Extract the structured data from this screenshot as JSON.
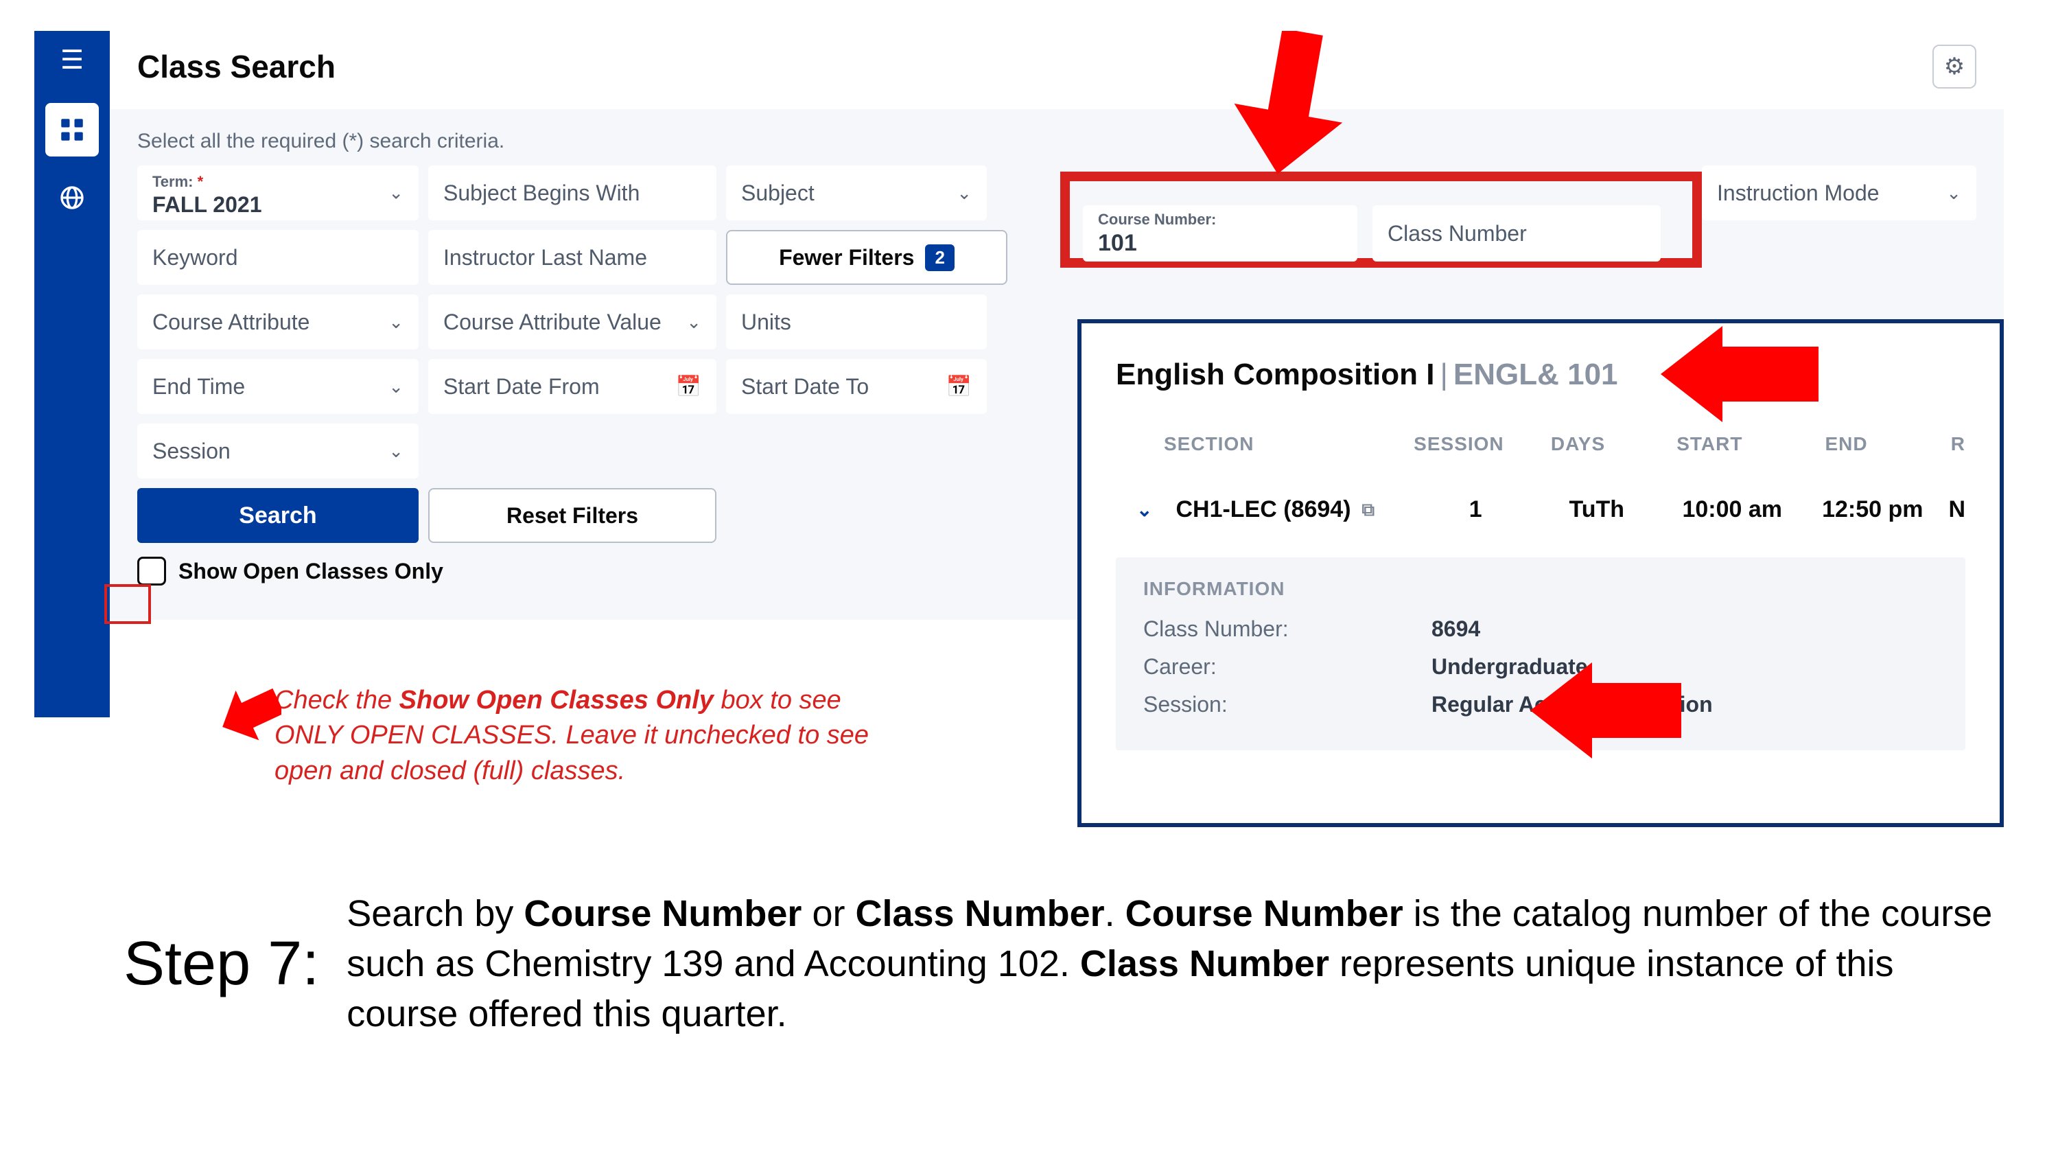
{
  "header": {
    "title": "Class Search"
  },
  "filters": {
    "criteria_label": "Select all the required (*) search criteria.",
    "term": {
      "label": "Term:",
      "required_mark": "*",
      "value": "FALL 2021"
    },
    "subject_begins": "Subject Begins With",
    "subject": "Subject",
    "course_number": {
      "label": "Course Number:",
      "value": "101"
    },
    "class_number_placeholder": "Class Number",
    "instruction_mode": "Instruction Mode",
    "keyword": "Keyword",
    "instructor_last_name": "Instructor Last Name",
    "fewer_filters": {
      "label": "Fewer Filters",
      "badge": "2"
    },
    "course_attribute": "Course Attribute",
    "course_attribute_value": "Course Attribute Value",
    "units": "Units",
    "end_time": "End Time",
    "start_date_from": "Start Date From",
    "start_date_to": "Start Date To",
    "session": "Session",
    "search": "Search",
    "reset": "Reset Filters",
    "open_only_label": "Show Open Classes Only"
  },
  "annotation": {
    "line1_a": "Check the ",
    "line1_bold": "Show Open Classes Only",
    "line1_b": " box to see",
    "line2": "ONLY OPEN CLASSES. Leave it unchecked to see",
    "line3": "open and closed (full) classes."
  },
  "detail": {
    "title": "English Composition I",
    "code": "ENGL& 101",
    "columns": {
      "section": "SECTION",
      "session": "SESSION",
      "days": "DAYS",
      "start": "START",
      "end": "END",
      "r": "R"
    },
    "row": {
      "section": "CH1-LEC (8694)",
      "session": "1",
      "days": "TuTh",
      "start": "10:00 am",
      "end": "12:50 pm",
      "r": "N"
    },
    "info_header": "INFORMATION",
    "info": {
      "class_number_k": "Class Number:",
      "class_number_v": "8694",
      "career_k": "Career:",
      "career_v": "Undergraduate",
      "session_k": "Session:",
      "session_v": "Regular Academic Session"
    }
  },
  "step": {
    "label": "Step 7:",
    "t1": "Search by ",
    "b1": "Course Number",
    "t2": " or ",
    "b2": "Class Number",
    "t3": ".  ",
    "b3": "Course Number",
    "t4": " is the catalog number of the course such as Chemistry 139 and Accounting 102. ",
    "b4": "Class Number",
    "t5": " represents unique instance of this course offered this quarter."
  }
}
